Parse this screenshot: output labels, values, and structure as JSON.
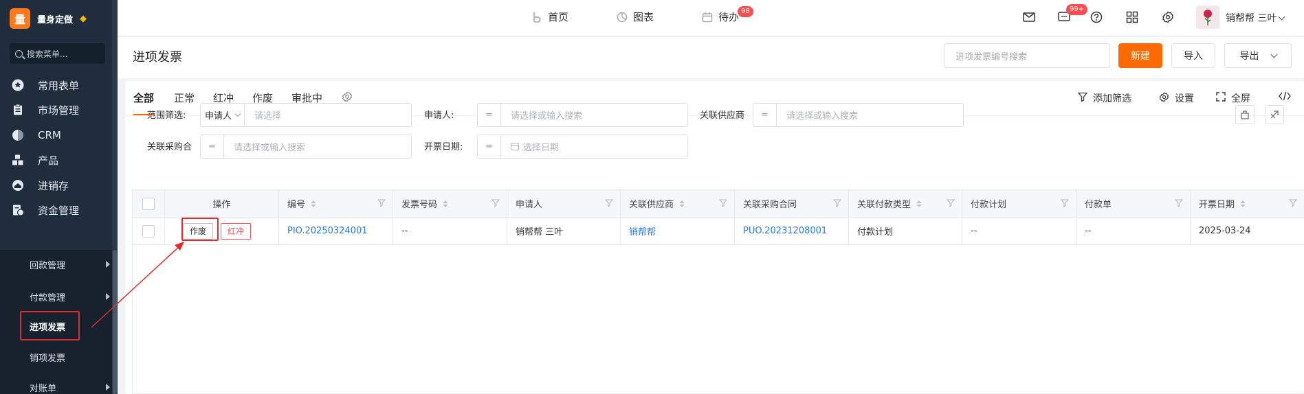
{
  "sidebar": {
    "brand_logo": "量",
    "brand_name": "量身定做",
    "search_placeholder": "搜索菜单...",
    "menu": [
      {
        "label": "常用表单",
        "icon": "star-icon"
      },
      {
        "label": "市场管理",
        "icon": "clipboard-icon"
      },
      {
        "label": "CRM",
        "icon": "pie-icon"
      },
      {
        "label": "产品",
        "icon": "boxes-icon"
      },
      {
        "label": "进销存",
        "icon": "warehouse-icon"
      },
      {
        "label": "资金管理",
        "icon": "money-doc-icon"
      }
    ],
    "submenu": [
      {
        "label": "回款管理",
        "has_children": true
      },
      {
        "label": "付款管理",
        "has_children": true
      },
      {
        "label": "进项发票",
        "has_children": false,
        "active": true
      },
      {
        "label": "销项发票",
        "has_children": false
      },
      {
        "label": "对账单",
        "has_children": true
      }
    ]
  },
  "topbar": {
    "nav": [
      {
        "label": "首页",
        "icon": "b-icon"
      },
      {
        "label": "图表",
        "icon": "pie-chart-icon"
      },
      {
        "label": "待办",
        "icon": "calendar-icon",
        "badge": "98"
      }
    ],
    "message_badge": "99+",
    "user_name": "销帮帮 三叶"
  },
  "page": {
    "title": "进项发票",
    "search_placeholder": "进项发票编号搜索",
    "new_label": "新建",
    "import_label": "导入",
    "export_label": "导出"
  },
  "tabs": [
    "全部",
    "正常",
    "红冲",
    "作废",
    "审批中"
  ],
  "tab_actions": {
    "add_filter": "添加筛选",
    "settings": "设置",
    "fullscreen": "全屏"
  },
  "filters": {
    "scope_label": "范围筛选:",
    "scope_value": "申请人",
    "scope_placeholder": "请选择",
    "applicant_label": "申请人:",
    "applicant_placeholder": "请选择或输入搜索",
    "supplier_label": "关联供应商",
    "supplier_placeholder": "请选择或输入搜索",
    "contract_label": "关联采购合",
    "contract_placeholder": "请选择或输入搜索",
    "date_label": "开票日期:",
    "date_placeholder": "选择日期"
  },
  "table": {
    "columns": [
      "操作",
      "编号",
      "发票号码",
      "申请人",
      "关联供应商",
      "关联采购合同",
      "关联付款类型",
      "付款计划",
      "付款单",
      "开票日期"
    ],
    "rows": [
      {
        "op_void": "作废",
        "op_red": "红冲",
        "number": "PIO.20250324001",
        "invoice_no": "--",
        "applicant": "销帮帮 三叶",
        "supplier": "销帮帮",
        "contract": "PUO.20231208001",
        "payment_type": "付款计划",
        "payment_plan": "--",
        "payment_doc": "--",
        "invoice_date": "2025-03-24"
      }
    ]
  },
  "colors": {
    "accent": "#ff6a00",
    "sidebar_bg": "#1f2d3d",
    "link": "#2a7ae2",
    "danger": "#ff4d4f",
    "annotation": "#e12a2a"
  }
}
